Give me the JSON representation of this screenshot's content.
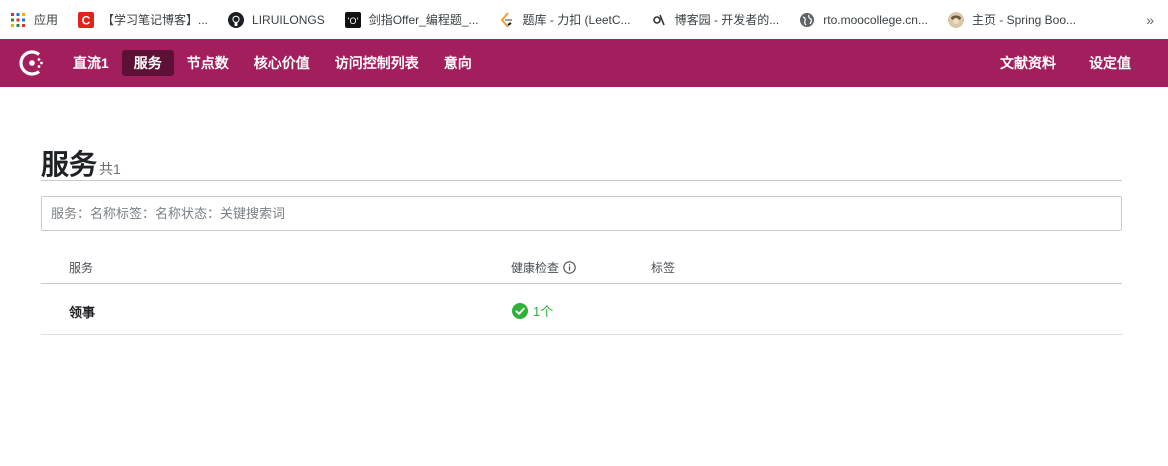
{
  "bookmarks": [
    {
      "icon": "apps-grid-icon",
      "label": "应用"
    },
    {
      "icon": "csdn-icon",
      "label": "【学习笔记博客】..."
    },
    {
      "icon": "github-icon",
      "label": "LIRUILONGS"
    },
    {
      "icon": "nowcoder-icon",
      "label": "剑指Offer_编程题_..."
    },
    {
      "icon": "leetcode-icon",
      "label": "题库 - 力扣 (LeetC..."
    },
    {
      "icon": "cnblogs-icon",
      "label": "博客园 - 开发者的..."
    },
    {
      "icon": "globe-icon",
      "label": "rto.moocollege.cn..."
    },
    {
      "icon": "avatar-icon",
      "label": "主页 - Spring Boo..."
    }
  ],
  "bookmarks_more": "»",
  "nav": {
    "items": [
      "直流1",
      "服务",
      "节点数",
      "核心价值",
      "访问控制列表",
      "意向"
    ],
    "active_index": 1,
    "right_items": [
      "文献资料",
      "设定值"
    ],
    "brand_color": "#a21e5c",
    "active_color": "#5e1136"
  },
  "page": {
    "title": "服务",
    "count": "共1"
  },
  "search": {
    "placeholder": "服务：名称标签：名称状态：关键搜索词",
    "value": ""
  },
  "table": {
    "headers": {
      "service": "服务",
      "health": "健康检查",
      "tags": "标签"
    },
    "rows": [
      {
        "name": "领事",
        "health": "1个",
        "tags": ""
      }
    ]
  },
  "colors": {
    "healthy": "#2eb039"
  }
}
